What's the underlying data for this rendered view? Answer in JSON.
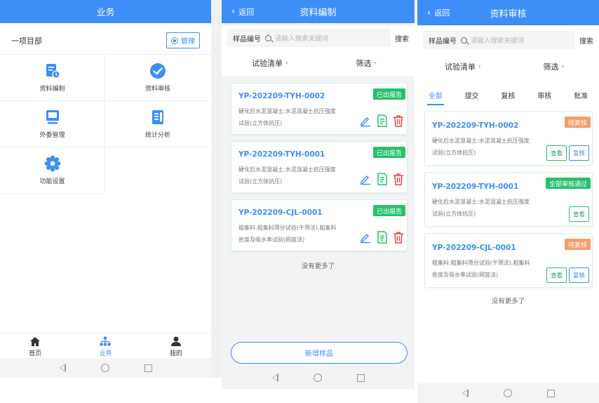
{
  "colors": {
    "primary": "#3d8ef7",
    "success": "#27c06b",
    "warning": "#f59d6b",
    "danger": "#e24a4a"
  },
  "screen1": {
    "title": "业务",
    "department": "一项目部",
    "manage_label": "管理",
    "grid": [
      {
        "label": "资料编制",
        "icon": "document-edit-icon"
      },
      {
        "label": "资料审核",
        "icon": "check-circle-icon"
      },
      {
        "label": "外委管理",
        "icon": "monitor-icon"
      },
      {
        "label": "统计分析",
        "icon": "report-icon"
      },
      {
        "label": "功能设置",
        "icon": "gear-icon"
      }
    ],
    "tabs": [
      {
        "label": "首页",
        "icon": "home-icon"
      },
      {
        "label": "业务",
        "icon": "org-icon"
      },
      {
        "label": "我的",
        "icon": "user-icon"
      }
    ]
  },
  "screen2": {
    "title": "资料编制",
    "back": "返回",
    "search": {
      "label": "样品编号",
      "placeholder": "请输入搜索关键词",
      "button": "搜索"
    },
    "filter": {
      "left": "试验清单",
      "right": "筛选"
    },
    "cards": [
      {
        "code": "YP-202209-TYH-0002",
        "status": "已出报告",
        "desc_line1": "硬化后水泥混凝土:水泥混凝土抗压强度",
        "desc_line2": "试验(立方体抗压)"
      },
      {
        "code": "YP-202209-TYH-0001",
        "status": "已出报告",
        "desc_line1": "硬化后水泥混凝土:水泥混凝土抗压强度",
        "desc_line2": "试验(立方体抗压)"
      },
      {
        "code": "YP-202209-CJL-0001",
        "status": "已出报告",
        "desc_line1": "粗集料:粗集料筛分试验(干筛法),粗集料",
        "desc_line2": "密度及吸水率试验(网篮法)"
      }
    ],
    "no_more": "没有更多了",
    "add_label": "新增样品"
  },
  "screen3": {
    "title": "资料审核",
    "back": "返回",
    "search": {
      "label": "样品编号",
      "placeholder": "请输入搜索关键词",
      "button": "搜索"
    },
    "filter": {
      "left": "试验清单",
      "right": "筛选"
    },
    "tabs": [
      "全部",
      "提交",
      "复核",
      "审核",
      "批准"
    ],
    "cards": [
      {
        "code": "YP-202209-TYH-0002",
        "status": "待复核",
        "status_color": "#f59d6b",
        "desc_line1": "硬化后水泥混凝土:水泥混凝土抗压强度",
        "desc_line2": "试验(立方体抗压)",
        "view": "查看",
        "review": "复核"
      },
      {
        "code": "YP-202209-TYH-0001",
        "status": "全部审核通过",
        "status_color": "#27c06b",
        "desc_line1": "硬化后水泥混凝土:水泥混凝土抗压强度",
        "desc_line2": "试验(立方体抗压)",
        "view": "查看"
      },
      {
        "code": "YP-202209-CJL-0001",
        "status": "待复核",
        "status_color": "#f59d6b",
        "desc_line1": "粗集料:粗集料筛分试验(干筛法),粗集料",
        "desc_line2": "密度及吸水率试验(网篮法)",
        "view": "查看",
        "review": "复核"
      }
    ],
    "no_more": "没有更多了"
  }
}
